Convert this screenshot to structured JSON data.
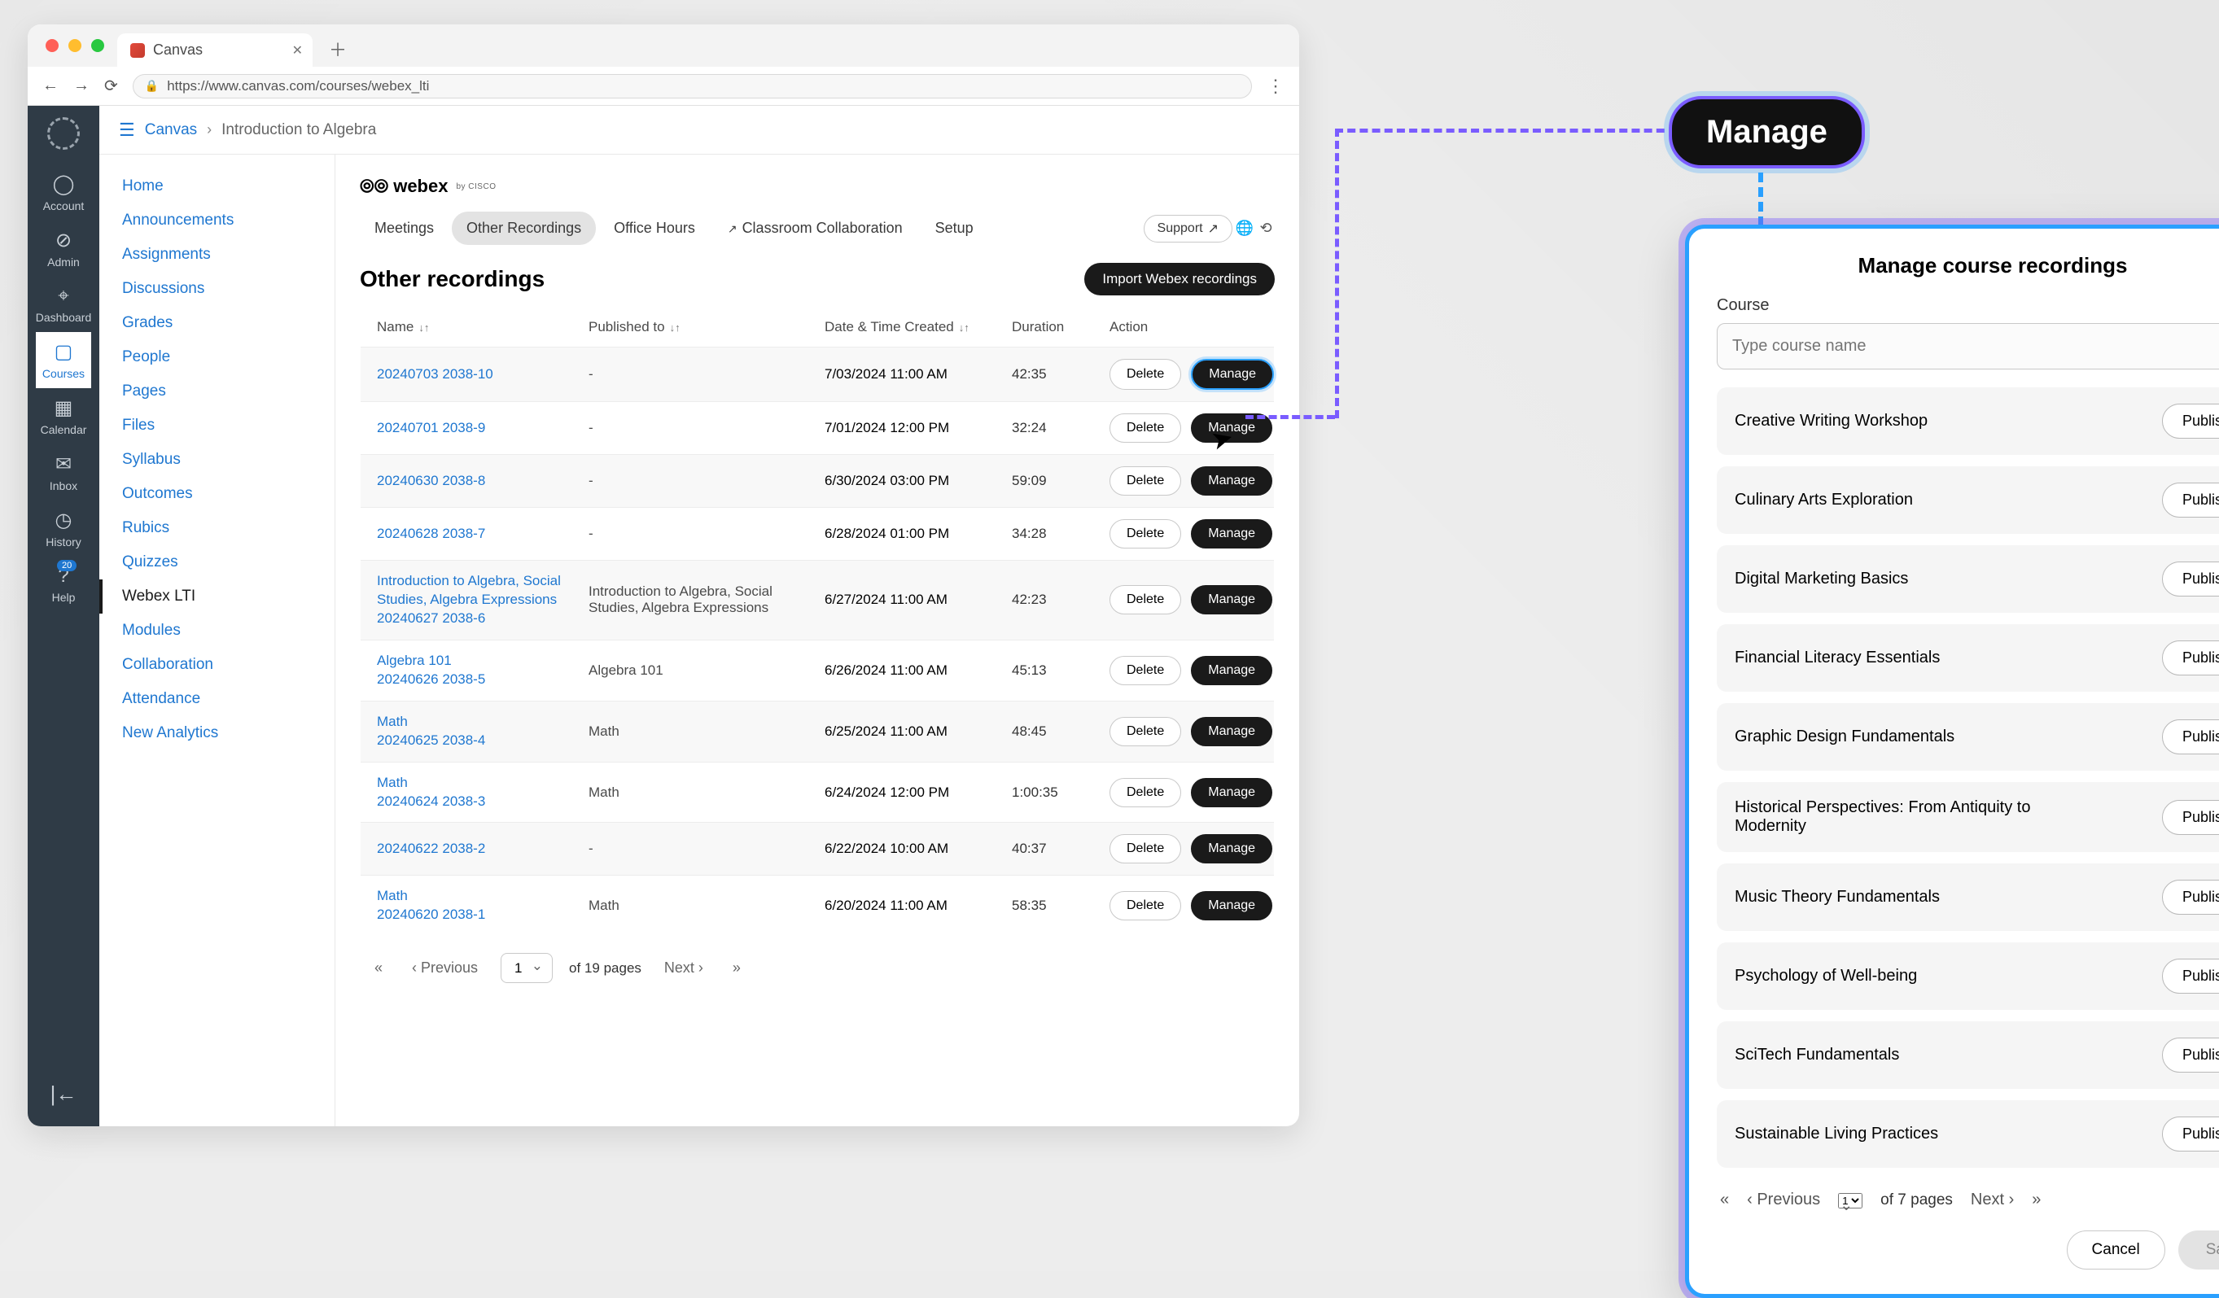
{
  "browser": {
    "tab_title": "Canvas",
    "url": "https://www.canvas.com/courses/webex_lti"
  },
  "global_nav": [
    {
      "icon": "◯",
      "label": "Account"
    },
    {
      "icon": "⊘",
      "label": "Admin"
    },
    {
      "icon": "⌖",
      "label": "Dashboard"
    },
    {
      "icon": "▢",
      "label": "Courses",
      "active": true
    },
    {
      "icon": "▦",
      "label": "Calendar"
    },
    {
      "icon": "✉",
      "label": "Inbox"
    },
    {
      "icon": "◷",
      "label": "History"
    },
    {
      "icon": "?",
      "label": "Help",
      "badge": "20"
    }
  ],
  "breadcrumb": {
    "root": "Canvas",
    "leaf": "Introduction to Algebra"
  },
  "course_nav": [
    "Home",
    "Announcements",
    "Assignments",
    "Discussions",
    "Grades",
    "People",
    "Pages",
    "Files",
    "Syllabus",
    "Outcomes",
    "Rubics",
    "Quizzes",
    "Webex LTI",
    "Modules",
    "Collaboration",
    "Attendance",
    "New Analytics"
  ],
  "course_nav_active": "Webex LTI",
  "webex": {
    "brand": "webex",
    "brand_sub": "by CISCO",
    "tabs": [
      "Meetings",
      "Other Recordings",
      "Office Hours",
      "Classroom Collaboration",
      "Setup"
    ],
    "tab_active": "Other Recordings",
    "support": "Support",
    "heading": "Other recordings",
    "import_btn": "Import Webex recordings",
    "columns": {
      "name": "Name",
      "published": "Published to",
      "created": "Date & Time Created",
      "duration": "Duration",
      "action": "Action"
    },
    "delete_label": "Delete",
    "manage_label": "Manage",
    "rows": [
      {
        "name": [
          "20240703 2038-10"
        ],
        "published": "-",
        "dt": "7/03/2024 11:00 AM",
        "dur": "42:35",
        "hi": true
      },
      {
        "name": [
          "20240701 2038-9"
        ],
        "published": "-",
        "dt": "7/01/2024 12:00 PM",
        "dur": "32:24"
      },
      {
        "name": [
          "20240630 2038-8"
        ],
        "published": "-",
        "dt": "6/30/2024 03:00 PM",
        "dur": "59:09"
      },
      {
        "name": [
          "20240628 2038-7"
        ],
        "published": "-",
        "dt": "6/28/2024 01:00 PM",
        "dur": "34:28"
      },
      {
        "name": [
          "Introduction to Algebra, Social Studies, Algebra Expressions",
          "20240627 2038-6"
        ],
        "published": "Introduction to Algebra, Social Studies, Algebra Expressions",
        "dt": "6/27/2024 11:00 AM",
        "dur": "42:23"
      },
      {
        "name": [
          "Algebra 101",
          "20240626 2038-5"
        ],
        "published": "Algebra 101",
        "dt": "6/26/2024 11:00 AM",
        "dur": "45:13"
      },
      {
        "name": [
          "Math",
          "20240625 2038-4"
        ],
        "published": "Math",
        "dt": "6/25/2024 11:00 AM",
        "dur": "48:45"
      },
      {
        "name": [
          "Math",
          "20240624 2038-3"
        ],
        "published": "Math",
        "dt": "6/24/2024 12:00 PM",
        "dur": "1:00:35"
      },
      {
        "name": [
          "20240622 2038-2"
        ],
        "published": "-",
        "dt": "6/22/2024 10:00 AM",
        "dur": "40:37"
      },
      {
        "name": [
          "Math",
          "20240620 2038-1"
        ],
        "published": "Math",
        "dt": "6/20/2024 11:00 AM",
        "dur": "58:35"
      }
    ],
    "pager": {
      "prev": "Previous",
      "next": "Next",
      "page": "1",
      "total": "of 19 pages"
    }
  },
  "callout": "Manage",
  "modal": {
    "title": "Manage course recordings",
    "course_label": "Course",
    "placeholder": "Type course name",
    "publish_label": "Publish",
    "courses": [
      "Creative Writing Workshop",
      "Culinary Arts Exploration",
      "Digital Marketing Basics",
      "Financial Literacy Essentials",
      "Graphic Design Fundamentals",
      "Historical Perspectives: From Antiquity to Modernity",
      "Music Theory Fundamentals",
      "Psychology of Well-being",
      "SciTech Fundamentals",
      "Sustainable Living Practices"
    ],
    "pager": {
      "prev": "Previous",
      "next": "Next",
      "page": "1",
      "total": "of 7 pages"
    },
    "cancel": "Cancel",
    "save": "Save"
  }
}
